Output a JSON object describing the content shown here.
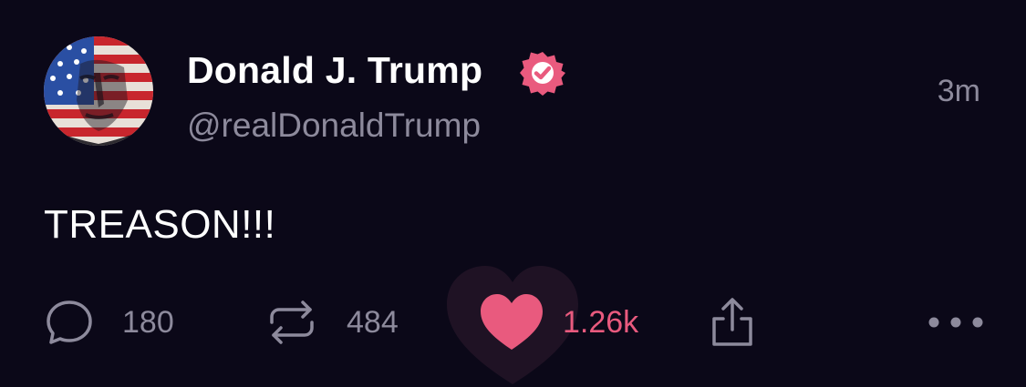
{
  "post": {
    "author": {
      "display_name": "Donald J. Trump",
      "handle": "@realDonaldTrump",
      "verified": true,
      "avatar": "flag-painted-portrait"
    },
    "timestamp": "3m",
    "text": "TREASON!!!",
    "actions": {
      "reply": {
        "icon": "speech-bubble-icon",
        "count": "180"
      },
      "repost": {
        "icon": "repost-arrows-icon",
        "count": "484"
      },
      "like": {
        "icon": "heart-icon",
        "count": "1.26k",
        "active": true
      },
      "share": {
        "icon": "share-upload-icon"
      },
      "more": {
        "icon": "more-dots-icon"
      }
    }
  },
  "colors": {
    "background": "#0b0818",
    "primary_text": "#ffffff",
    "secondary_text": "#8d8a9c",
    "accent_pink": "#e95a7e"
  }
}
